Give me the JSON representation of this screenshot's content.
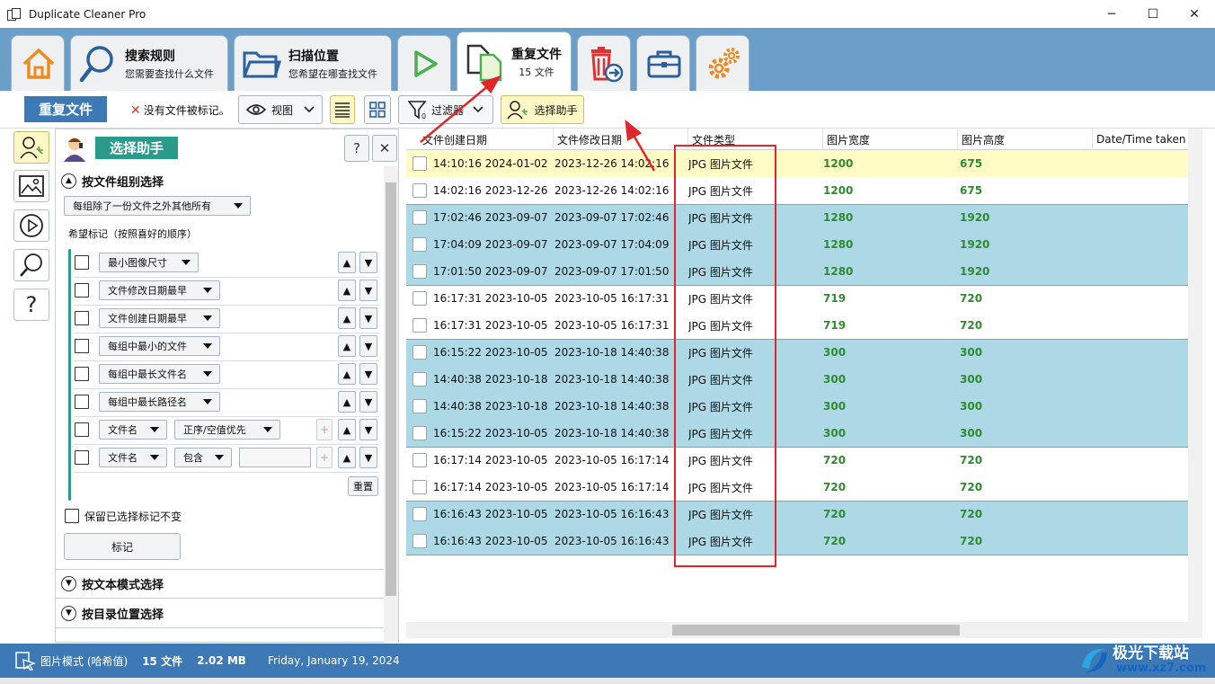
{
  "window": {
    "title": "Duplicate Cleaner Pro",
    "min": "─",
    "max": "☐",
    "close": "✕"
  },
  "tabs": [
    {
      "id": "home",
      "icon": "home-icon"
    },
    {
      "id": "search-rules",
      "icon": "search-icon",
      "title": "搜索规则",
      "subtitle": "您需要查找什么文件"
    },
    {
      "id": "scan-location",
      "icon": "folder-icon",
      "title": "扫描位置",
      "subtitle": "您希望在哪查找文件"
    },
    {
      "id": "start-scan",
      "icon": "play-icon"
    },
    {
      "id": "duplicate-files",
      "icon": "duplicate-files-icon",
      "title": "重复文件",
      "subtitle": "15 文件"
    },
    {
      "id": "removal",
      "icon": "trash-icon"
    },
    {
      "id": "toolbox",
      "icon": "toolbox-icon"
    },
    {
      "id": "settings",
      "icon": "gears-icon"
    }
  ],
  "toolbar": {
    "title": "重复文件",
    "no_marked": "没有文件被标记。",
    "view_label": "视图",
    "filter_label": "过滤器",
    "assistant_label": "选择助手"
  },
  "panel": {
    "title": "选择助手",
    "help_label": "?",
    "close_label": "✕",
    "section1": "按文件组别选择",
    "group_mode": "每组除了一份文件之外其他所有",
    "prefer_label": "希望标记（按照喜好的顺序）",
    "criteria": [
      "最小图像尺寸",
      "文件修改日期最早",
      "文件创建日期最早",
      "每组中最小的文件",
      "每组中最长文件名",
      "每组中最长路径名"
    ],
    "name_row1": {
      "field": "文件名",
      "op": "正序/空值优先"
    },
    "name_row2": {
      "field": "文件名",
      "op": "包含"
    },
    "reset_label": "重置",
    "keep_label": "保留已选择标记不变",
    "mark_label": "标记",
    "section2": "按文本模式选择",
    "section3": "按目录位置选择",
    "up": "▲",
    "down": "▼",
    "plus": "+"
  },
  "table": {
    "headers": [
      "文件创建日期",
      "文件修改日期",
      "文件类型",
      "图片宽度",
      "图片高度",
      "Date/Time taken"
    ],
    "rows": [
      {
        "created": "2024-01-02 14:10:16",
        "modified": "2023-12-26 14:02:16",
        "type": "JPG 图片文件",
        "width": "1200",
        "height": "675",
        "style": "hl"
      },
      {
        "created": "2023-12-26 14:02:16",
        "modified": "2023-12-26 14:02:16",
        "type": "JPG 图片文件",
        "width": "1200",
        "height": "675",
        "style": "white"
      },
      {
        "created": "2023-09-07 17:02:46",
        "modified": "2023-09-07 17:02:46",
        "type": "JPG 图片文件",
        "width": "1280",
        "height": "1920",
        "style": "blue"
      },
      {
        "created": "2023-09-07 17:04:09",
        "modified": "2023-09-07 17:04:09",
        "type": "JPG 图片文件",
        "width": "1280",
        "height": "1920",
        "style": "blue"
      },
      {
        "created": "2023-09-07 17:01:50",
        "modified": "2023-09-07 17:01:50",
        "type": "JPG 图片文件",
        "width": "1280",
        "height": "1920",
        "style": "blue"
      },
      {
        "created": "2023-10-05 16:17:31",
        "modified": "2023-10-05 16:17:31",
        "type": "JPG 图片文件",
        "width": "719",
        "height": "720",
        "style": "white"
      },
      {
        "created": "2023-10-05 16:17:31",
        "modified": "2023-10-05 16:17:31",
        "type": "JPG 图片文件",
        "width": "719",
        "height": "720",
        "style": "white"
      },
      {
        "created": "2023-10-05 16:15:22",
        "modified": "2023-10-18 14:40:38",
        "type": "JPG 图片文件",
        "width": "300",
        "height": "300",
        "style": "blue"
      },
      {
        "created": "2023-10-18 14:40:38",
        "modified": "2023-10-18 14:40:38",
        "type": "JPG 图片文件",
        "width": "300",
        "height": "300",
        "style": "blue"
      },
      {
        "created": "2023-10-18 14:40:38",
        "modified": "2023-10-18 14:40:38",
        "type": "JPG 图片文件",
        "width": "300",
        "height": "300",
        "style": "blue"
      },
      {
        "created": "2023-10-05 16:15:22",
        "modified": "2023-10-18 14:40:38",
        "type": "JPG 图片文件",
        "width": "300",
        "height": "300",
        "style": "blue"
      },
      {
        "created": "2023-10-05 16:17:14",
        "modified": "2023-10-05 16:17:14",
        "type": "JPG 图片文件",
        "width": "720",
        "height": "720",
        "style": "white"
      },
      {
        "created": "2023-10-05 16:17:14",
        "modified": "2023-10-05 16:17:14",
        "type": "JPG 图片文件",
        "width": "720",
        "height": "720",
        "style": "white"
      },
      {
        "created": "2023-10-05 16:16:43",
        "modified": "2023-10-05 16:16:43",
        "type": "JPG 图片文件",
        "width": "720",
        "height": "720",
        "style": "blue"
      },
      {
        "created": "2023-10-05 16:16:43",
        "modified": "2023-10-05 16:16:43",
        "type": "JPG 图片文件",
        "width": "720",
        "height": "720",
        "style": "blue"
      }
    ]
  },
  "status": {
    "mode": "图片模式 (哈希值)",
    "count": "15 文件",
    "size": "2.02 MB",
    "date": "Friday, January 19, 2024"
  },
  "watermark": {
    "text": "极光下载站",
    "url": "www.xz7.com"
  },
  "colors": {
    "accent": "#3d7ab5",
    "teal": "#2a9a8a",
    "highlight": "#fffbc4",
    "group": "#add8e6",
    "number": "#2e8b2e",
    "annotation": "#e0262b"
  }
}
